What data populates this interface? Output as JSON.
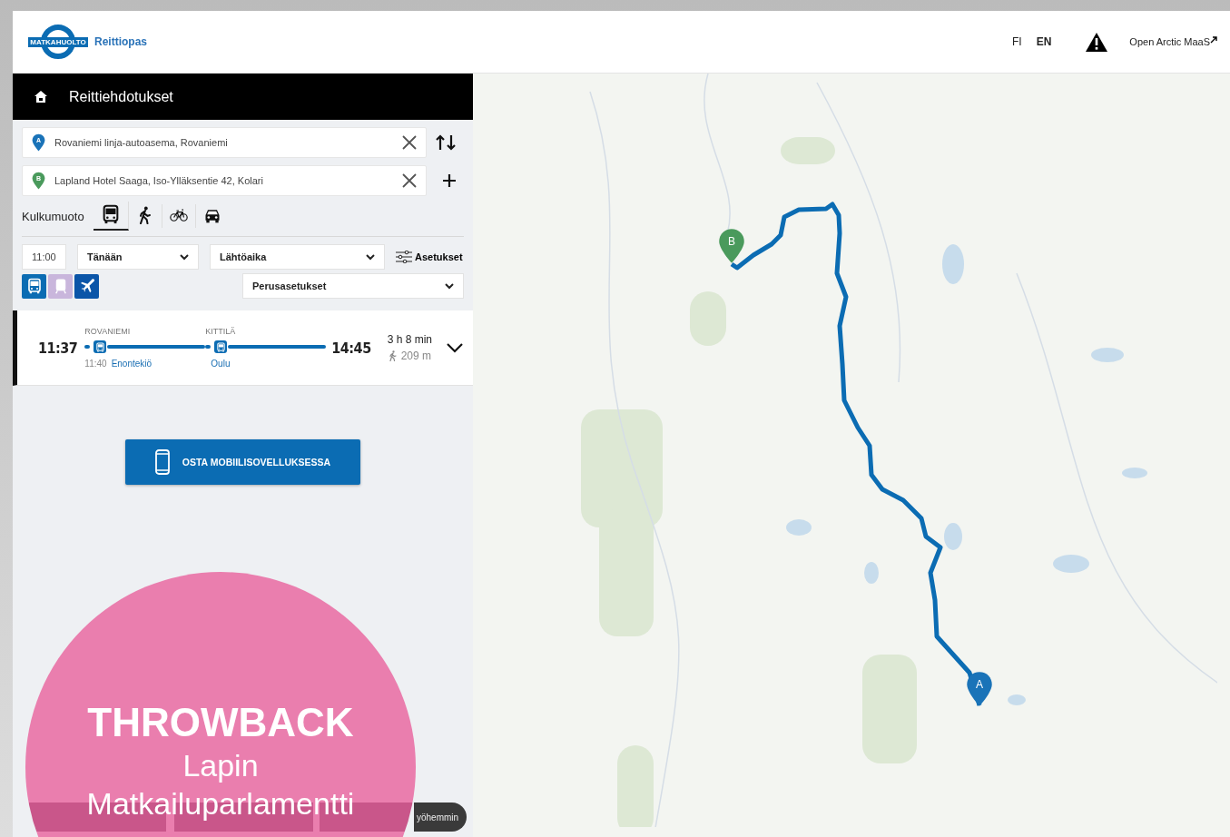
{
  "header": {
    "logo_text": "MATKAHUOLTO",
    "app_name": "Reittiopas",
    "languages": [
      {
        "label": "FI",
        "selected": false
      },
      {
        "label": "EN",
        "selected": true
      }
    ],
    "external_link": "Open Arctic MaaS"
  },
  "panel": {
    "title": "Reittiehdotukset",
    "from": {
      "marker": "A",
      "value": "Rovaniemi linja-autoasema, Rovaniemi"
    },
    "to": {
      "marker": "B",
      "value": "Lapland Hotel Saaga, Iso-Ylläksentie 42, Kolari"
    },
    "mode_label": "Kulkumuoto",
    "modes": [
      {
        "kind": "bus",
        "selected": true
      },
      {
        "kind": "walk",
        "selected": false
      },
      {
        "kind": "bike",
        "selected": false
      },
      {
        "kind": "car",
        "selected": false
      }
    ],
    "time": "11:00",
    "day": "Tänään",
    "time_type": "Lähtöaika",
    "settings": "Asetukset",
    "transit_filters": [
      {
        "kind": "bus",
        "on": true
      },
      {
        "kind": "train",
        "on": false
      },
      {
        "kind": "plane",
        "on": true
      }
    ],
    "preset": "Perusasetukset"
  },
  "itinerary": {
    "selected": true,
    "depart": "11:37",
    "arrive": "14:45",
    "legs": [
      {
        "stop": "ROVANIEMI",
        "time": "11:40",
        "route": "Enontekiö"
      },
      {
        "stop": "KITTILÄ",
        "route": "Oulu"
      }
    ],
    "duration": "3 h 8 min",
    "walk": "209 m"
  },
  "buy_button": "OSTA MOBIILISOVELLUKSESSA",
  "bottom_buttons": [
    {
      "label": "yöhemmin"
    }
  ],
  "map": {
    "markers": [
      {
        "label": "A",
        "color": "#1a73b8"
      },
      {
        "label": "B",
        "color": "#4a9a5c"
      }
    ]
  },
  "overlay": {
    "title": "THROWBACK",
    "lines": [
      "Lapin",
      "Matkailuparlamentti"
    ]
  }
}
